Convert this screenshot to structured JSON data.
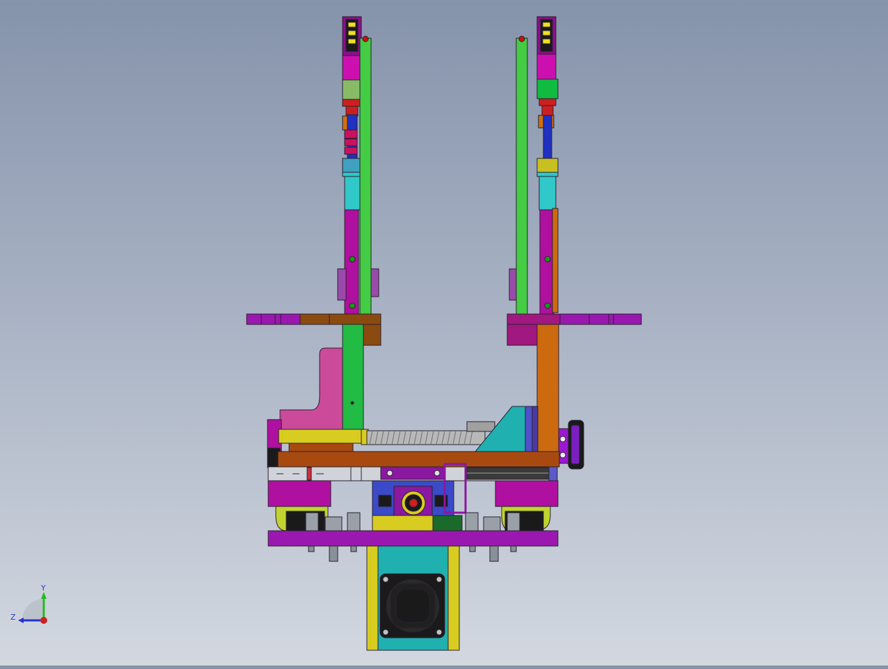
{
  "viewport": {
    "colors": {
      "background_top": "#8593ab",
      "background_bottom": "#d3d8e0",
      "outline": "#2a2030"
    }
  },
  "triad": {
    "y_label": "Y",
    "z_label": "Z",
    "colors": {
      "y_axis": "#22bb22",
      "z_axis": "#2233cc",
      "x_axis": "#cc2222"
    }
  }
}
